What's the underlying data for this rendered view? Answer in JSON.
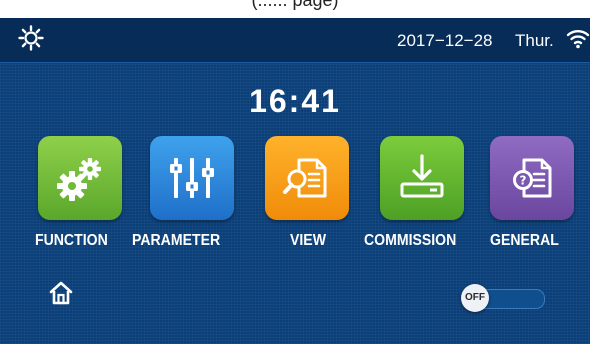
{
  "caption": "(...... page)",
  "status_bar": {
    "sun_icon": "sun-icon",
    "date": "2017−12−28",
    "day": "Thur.",
    "wifi_icon": "wifi-icon"
  },
  "clock": "16:41",
  "apps": [
    {
      "label": "FUNCTION",
      "icon": "gears-icon",
      "color": "#6dbb36"
    },
    {
      "label": "PARAMETER",
      "icon": "sliders-icon",
      "color": "#2a86dc"
    },
    {
      "label": "VIEW",
      "icon": "document-search-icon",
      "color": "#f59d1a"
    },
    {
      "label": "COMMISSION",
      "icon": "download-tray-icon",
      "color": "#63b52f"
    },
    {
      "label": "GENERAL",
      "icon": "document-help-icon",
      "color": "#7b57b0"
    }
  ],
  "footer": {
    "home_icon": "home-icon",
    "power_toggle": {
      "label": "OFF",
      "state": "off"
    }
  },
  "colors": {
    "background": "#0b3f79",
    "status_bar": "#072c58",
    "text": "#ffffff"
  }
}
